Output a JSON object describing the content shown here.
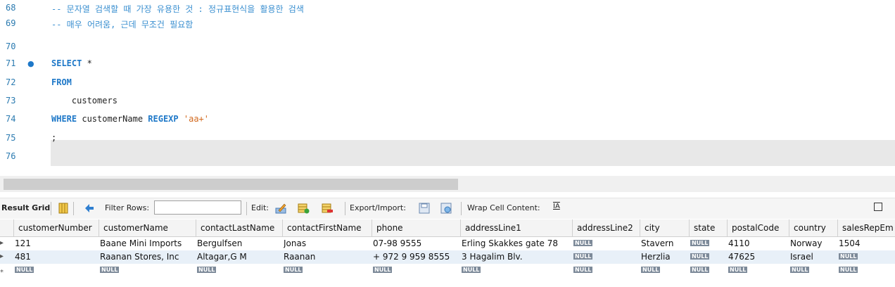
{
  "editor": {
    "lines": [
      {
        "num": "68",
        "segments": [
          {
            "cls": "cmt",
            "text": "-- 문자열 검색할 때 가장 유용한 것 : 정규표현식을 활용한 검색"
          }
        ]
      },
      {
        "num": "69",
        "segments": [
          {
            "cls": "cmt",
            "text": "-- 매우 어려움, 근데 무조건 필요함"
          }
        ]
      },
      {
        "num": "70",
        "segments": []
      },
      {
        "num": "71",
        "breakpoint": true,
        "segments": [
          {
            "cls": "kw",
            "text": "SELECT"
          },
          {
            "cls": "",
            "text": " *"
          }
        ]
      },
      {
        "num": "72",
        "segments": [
          {
            "cls": "kw",
            "text": "FROM"
          }
        ]
      },
      {
        "num": "73",
        "segments": [
          {
            "cls": "",
            "text": "    customers"
          }
        ]
      },
      {
        "num": "74",
        "segments": [
          {
            "cls": "kw",
            "text": "WHERE"
          },
          {
            "cls": "",
            "text": " customerName "
          },
          {
            "cls": "kw",
            "text": "REGEXP"
          },
          {
            "cls": "",
            "text": " "
          },
          {
            "cls": "str",
            "text": "'aa+'"
          }
        ]
      },
      {
        "num": "75",
        "segments": [
          {
            "cls": "",
            "text": ";"
          }
        ]
      },
      {
        "num": "76",
        "segments": []
      }
    ]
  },
  "toolbar": {
    "result_grid_label": "Result Grid",
    "filter_label": "Filter Rows:",
    "filter_value": "",
    "edit_label": "Edit:",
    "export_label": "Export/Import:",
    "wrap_label": "Wrap Cell Content:",
    "wrap_icon_text": "IA"
  },
  "grid": {
    "columns": [
      "customerNumber",
      "customerName",
      "contactLastName",
      "contactFirstName",
      "phone",
      "addressLine1",
      "addressLine2",
      "city",
      "state",
      "postalCode",
      "country",
      "salesRepEm"
    ],
    "rows": [
      [
        "121",
        "Baane Mini Imports",
        "Bergulfsen",
        "Jonas",
        "07-98 9555",
        "Erling Skakkes gate 78",
        "NULL",
        "Stavern",
        "NULL",
        "4110",
        "Norway",
        "1504"
      ],
      [
        "481",
        "Raanan Stores, Inc",
        "Altagar,G M",
        "Raanan",
        "+ 972 9 959 8555",
        "3 Hagalim Blv.",
        "NULL",
        "Herzlia",
        "NULL",
        "47625",
        "Israel",
        "NULL"
      ],
      [
        "NULL",
        "NULL",
        "NULL",
        "NULL",
        "NULL",
        "NULL",
        "NULL",
        "NULL",
        "NULL",
        "NULL",
        "NULL",
        "NULL"
      ]
    ],
    "null_text": "NULL",
    "new_row_marker": "*",
    "row_marker": "▸"
  }
}
